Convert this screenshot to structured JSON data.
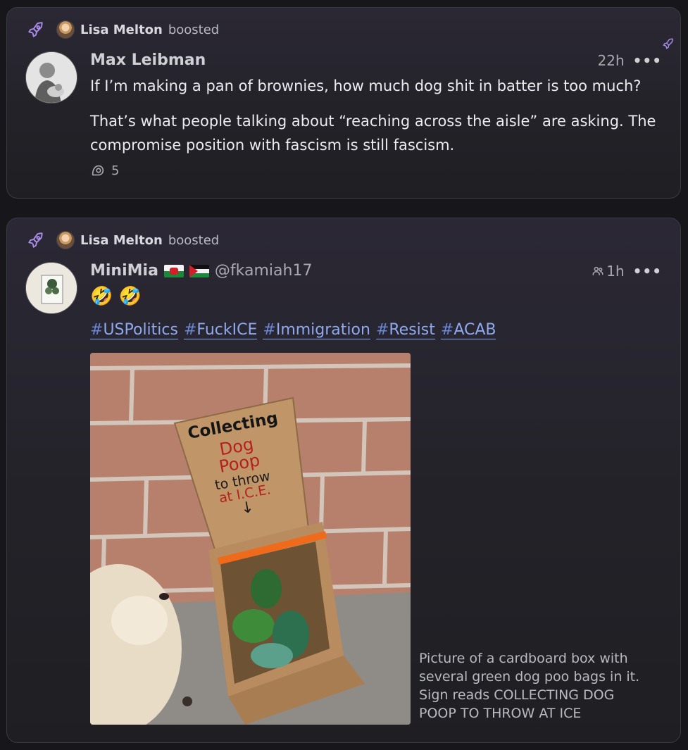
{
  "posts": [
    {
      "boost": {
        "booster": "Lisa Melton",
        "action": "boosted"
      },
      "author": {
        "display_name": "Max Leibman"
      },
      "time": "22h",
      "paragraphs": [
        "If I’m making a pan of brownies, how much dog shit in batter is too much?",
        "That’s what people talking about “reaching across the aisle” are asking. The compromise position with fascism is still fascism."
      ],
      "reply_count": "5"
    },
    {
      "boost": {
        "booster": "Lisa Melton",
        "action": "boosted"
      },
      "author": {
        "display_name": "MiniMia",
        "handle": "@fkamiah17"
      },
      "time": "1h",
      "emoji_line": "🤣 🤣",
      "hashtags": [
        "USPolitics",
        "FuckICE",
        "Immigration",
        "Resist",
        "ACAB"
      ],
      "image_sign": [
        "Collecting",
        "Dog",
        "Poop",
        "to throw",
        "at I.C.E."
      ],
      "alt_text": "Picture of a cardboard box with several green dog poo bags in it. Sign reads COLLECTING DOG POOP TO THROW AT ICE"
    }
  ],
  "colors": {
    "accent": "#a98ce8",
    "hashtag": "#8ea9ee",
    "background": "#17171b"
  },
  "icons": [
    "rocket-icon",
    "more-icon",
    "reply-icon",
    "followers-icon"
  ]
}
